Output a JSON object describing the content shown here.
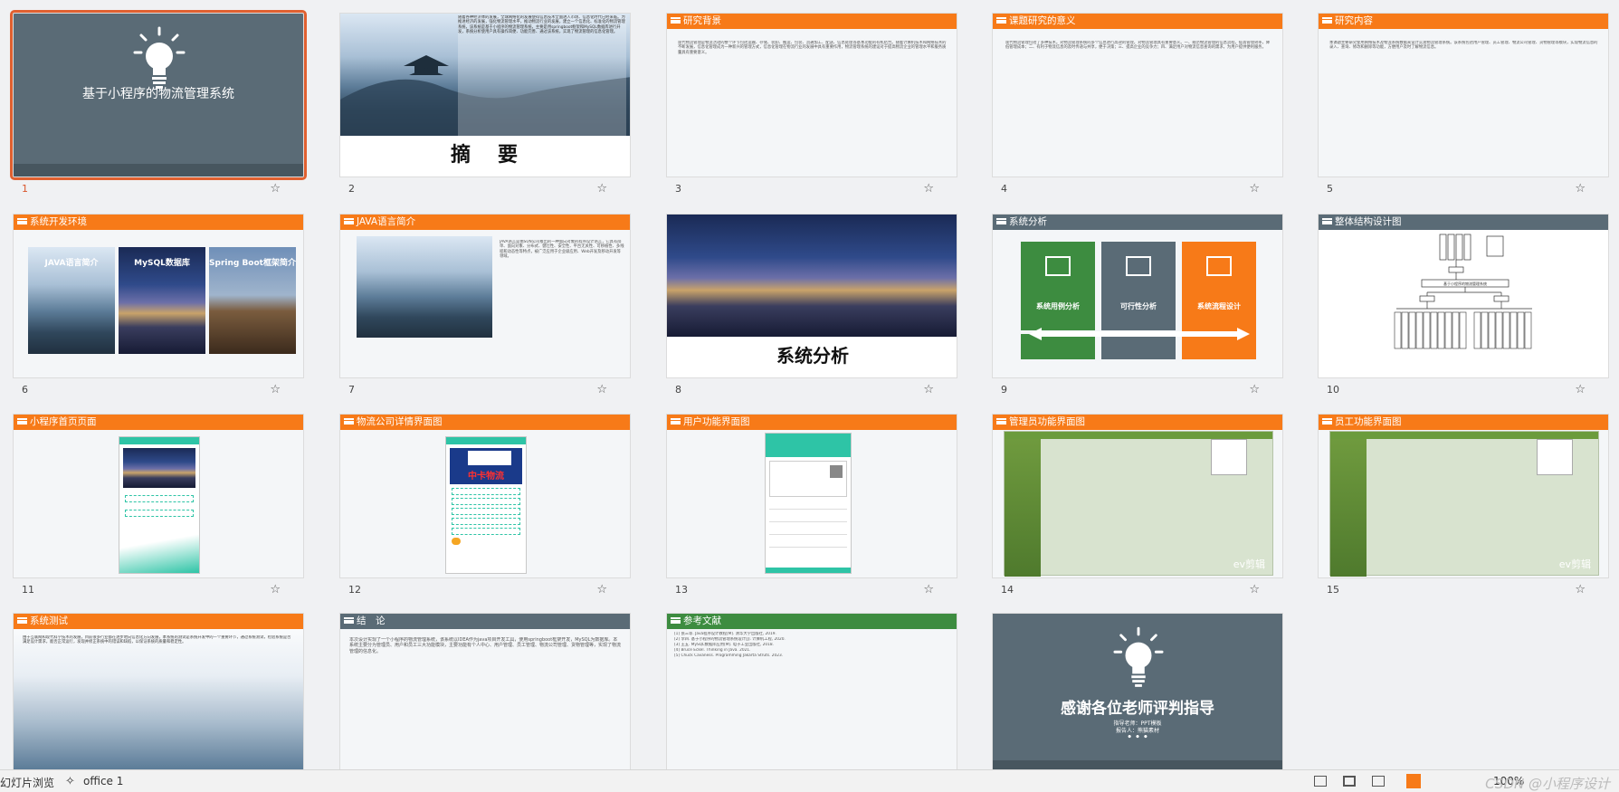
{
  "slides": [
    {
      "number": "1",
      "title": "基于小程序的物流管理系统"
    },
    {
      "number": "2",
      "title": "摘　要",
      "body": "随着各种经济体的发展，全球网络化的发展使得信息技术全面进入市场、信息化时代已经来临。为推进经济的发展，强化物流管理水平，推动物流行业的发展，建立一个信息化、标准化的物流管理系统，该系统是基于小程序的物流管理系统，主要是用springboot框架和MySQL数据库进行开发，系统分析使用户具有操作简便、功能完善、通过该系统，实现了物流管理的信息化管理。"
    },
    {
      "number": "3",
      "title": "研究背景",
      "body": "现代物流管理是物流活动的整个环节包括运输、存储、装卸、搬运、包装、流通加工、配送、信息处理等基本功能的有机结合。随着计算机技术和网络技术的不断发展，信息化管理成为一种新兴的管理方式，信息化管理在物流行业的发展中具有重要作用，物流管理系统的建设对于提高物流企业的管理水平和服务质量具有重要意义。"
    },
    {
      "number": "4",
      "title": "课题研究的意义",
      "body": "现代物流管理包括了多种技术。对物流管理系统的多个信息进行高效的管理，对物流管理具有重要意义。一、规范物流管理的信息流程，提高管理效率，降低管理成本；二、有利于物流信息的及时传递与共享，便于决策；三、提高企业的竞争力；四、满足用户对物流信息查询的需求，为用户提供便利服务。"
    },
    {
      "number": "5",
      "title": "研究内容",
      "body": "本课题主要研究使用网络技术及物流系统数据来设计实现物流管理系统。该系统包括用户管理、员工管理、物流公司管理、货物管理等模块，实现物流信息的录入、查询、修改和删除等功能，方便用户及时了解物流信息。"
    },
    {
      "number": "6",
      "title": "系统开发环境",
      "cards": [
        "JAVA语言简介",
        "MySQL数据库",
        "Spring Boot框架简介"
      ]
    },
    {
      "number": "7",
      "title": "JAVA语言简介",
      "body": "JAVA语言是由SUN公司推出的一种面向对象的程序设计语言，它具有简单、面向对象、分布式、健壮性、安全性、平台无关性、可移植性、多线程和动态性等特点，被广泛应用于企业级应用、Web开发及移动开发等领域。"
    },
    {
      "number": "8",
      "title": "系统分析"
    },
    {
      "number": "9",
      "title": "系统分析",
      "cards": [
        "系统用例分析",
        "可行性分析",
        "系统流程设计"
      ]
    },
    {
      "number": "10",
      "title": "整体结构设计图",
      "root": "基于小程序的物流管理系统"
    },
    {
      "number": "11",
      "title": "小程序首页页面"
    },
    {
      "number": "12",
      "title": "物流公司详情界面图",
      "logo": "中卡物流"
    },
    {
      "number": "13",
      "title": "用户功能界面图"
    },
    {
      "number": "14",
      "title": "管理员功能界面图",
      "watermark": "ev剪辑"
    },
    {
      "number": "15",
      "title": "员工功能界面图",
      "watermark": "ev剪辑"
    },
    {
      "number": "16",
      "title": "系统测试",
      "body": "由于互联网和现代科学技术的发展，目前很多行业都在逐步地向信息化方向发展，本系统的测试是系统开发中的一个重要环节，通过系统测试，检验系统是否满足设计需求，能否正常运行，发现并修正系统中的错误和缺陷，以保证系统的质量和稳定性。"
    },
    {
      "number": "17",
      "title": "结　论",
      "body": "本次设计实现了一个小程序的物流管理系统，该系统以IDEA作为java项目开发工具，使用springboot框架开发，MySQL为数据库。本系统主要分为管理员、用户和员工三大功能模块，主要功能有个人中心、用户管理、员工管理、物流公司管理、货物管理等，实现了物流管理的信息化。"
    },
    {
      "number": "18",
      "title": "参考文献",
      "refs": [
        "[1] 张三等. Java程序设计教程[M]. 清华大学出版社, 2019.",
        "[2] 李四. 基于小程序的物流管理系统设计[J]. 计算机工程, 2020.",
        "[3] 王五. MySQL数据库应用[M]. 电子工业出版社, 2018.",
        "[4] Bruce Eckel. Thinking in Java. 2021.",
        "[5] Chuck Cavaness. Programming Jakarta Struts. 2023."
      ]
    },
    {
      "number": "19",
      "title": "感谢各位老师评判指导",
      "advisor": "指导老师：PPT模板",
      "presenter": "报告人：熊猫素材",
      "dots": "• • •"
    }
  ],
  "statusbar": {
    "view_label": "幻灯片浏览",
    "theme_label": "office 1",
    "zoom": "100%"
  },
  "watermark": "CSDN @小程序设计",
  "colors": {
    "accent": "#f77a18",
    "slate": "#5a6b76",
    "green": "#3d8c40",
    "selection": "#e06030"
  },
  "icons": {
    "star": "star-icon",
    "bulb": "lightbulb-icon",
    "theme": "theme-icon"
  }
}
